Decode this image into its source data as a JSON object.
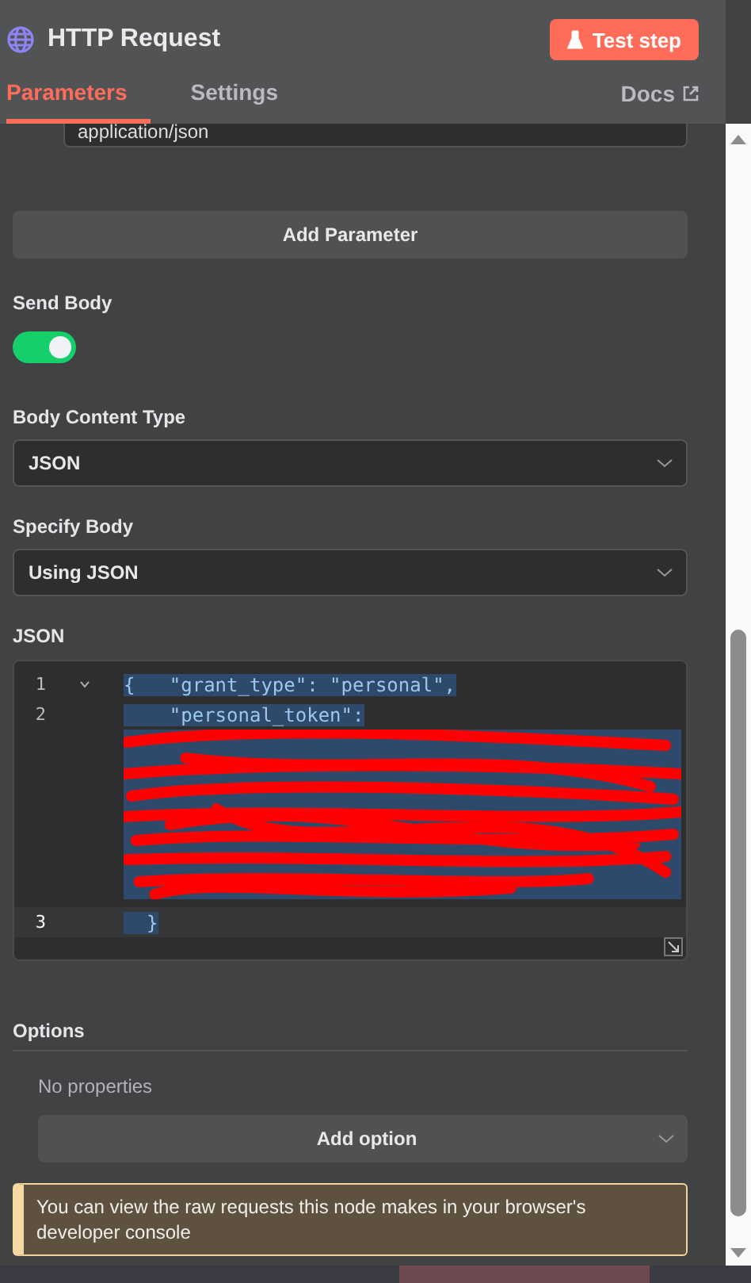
{
  "header": {
    "title": "HTTP Request",
    "test_button": "Test step"
  },
  "tabs": [
    {
      "label": "Parameters",
      "selected": true
    },
    {
      "label": "Settings",
      "selected": false
    }
  ],
  "docs_link": "Docs",
  "content_type_field": {
    "value": "application/json"
  },
  "add_parameter_button": "Add Parameter",
  "send_body": {
    "label": "Send Body",
    "on": true
  },
  "selects": [
    {
      "label": "Body Content Type",
      "value": "JSON"
    },
    {
      "label": "Specify Body",
      "value": "Using JSON"
    }
  ],
  "json_editor": {
    "label": "JSON",
    "lines": [
      {
        "kind": "code",
        "number": "1",
        "text": "{   \"grant_type\": \"personal\",",
        "foldable": true,
        "active": false
      },
      {
        "kind": "code",
        "number": "2",
        "text": "    \"personal_token\":",
        "foldable": false,
        "active": false
      },
      {
        "kind": "redacted"
      },
      {
        "kind": "code",
        "number": "3",
        "text": "  }",
        "foldable": false,
        "active": true
      }
    ]
  },
  "options": {
    "label": "Options",
    "empty_text": "No properties",
    "add_button": "Add option"
  },
  "notice": "You can view the raw requests this node makes in your browser's developer console"
}
